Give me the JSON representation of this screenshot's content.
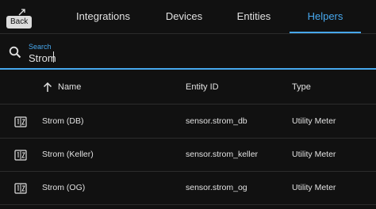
{
  "nav": {
    "back_label": "Back",
    "tabs": [
      {
        "label": "Integrations",
        "active": false
      },
      {
        "label": "Devices",
        "active": false
      },
      {
        "label": "Entities",
        "active": false
      },
      {
        "label": "Helpers",
        "active": true
      }
    ]
  },
  "search": {
    "label": "Search",
    "value": "Strom"
  },
  "table": {
    "columns": [
      "Name",
      "Entity ID",
      "Type"
    ],
    "sort": {
      "column": "Name",
      "direction": "ascending"
    },
    "rows": [
      {
        "icon": "counter-icon",
        "name": "Strom (DB)",
        "entity_id": "sensor.strom_db",
        "type": "Utility Meter"
      },
      {
        "icon": "counter-icon",
        "name": "Strom (Keller)",
        "entity_id": "sensor.strom_keller",
        "type": "Utility Meter"
      },
      {
        "icon": "counter-icon",
        "name": "Strom (OG)",
        "entity_id": "sensor.strom_og",
        "type": "Utility Meter"
      }
    ]
  },
  "colors": {
    "accent": "#47a8ee",
    "background": "#111111",
    "divider": "#2c2c2c",
    "text": "#e1e1e1"
  }
}
